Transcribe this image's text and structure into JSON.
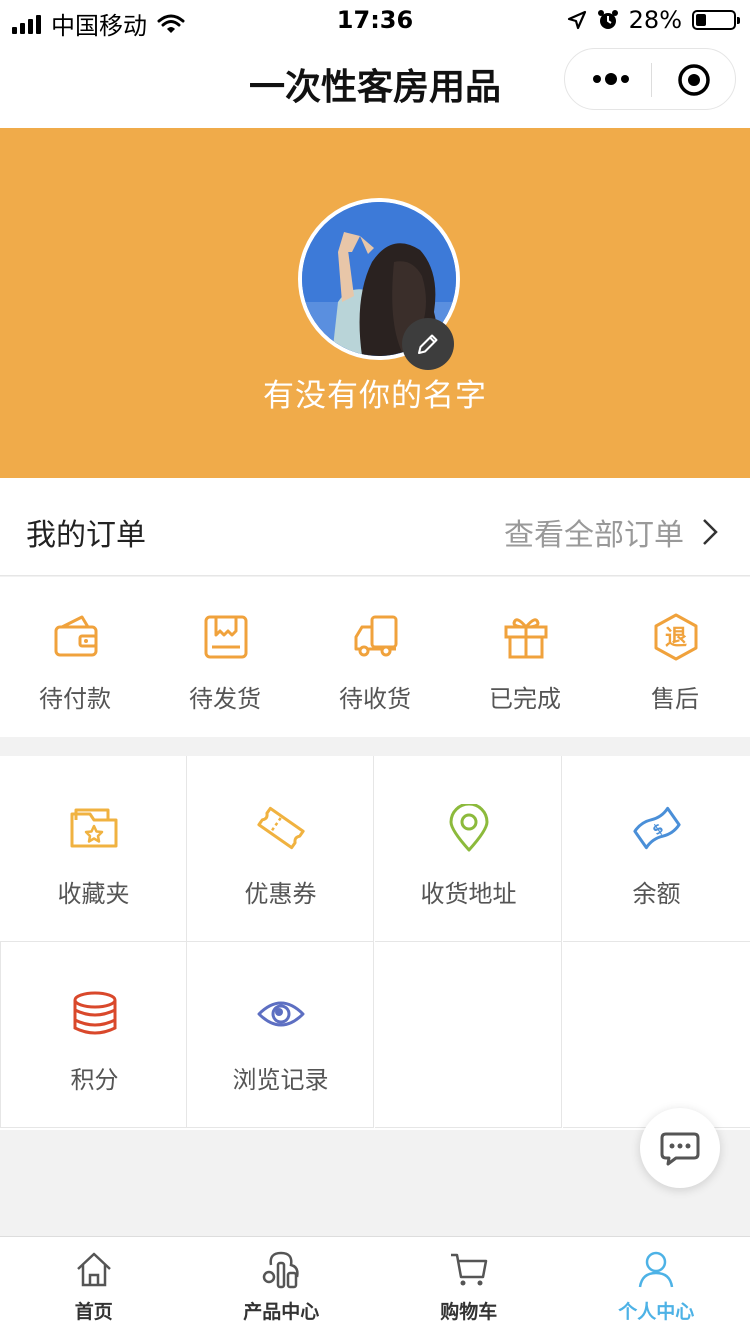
{
  "status_bar": {
    "carrier": "中国移动",
    "time": "17:36",
    "battery": "28%"
  },
  "nav": {
    "title": "一次性客房用品"
  },
  "profile": {
    "username": "有没有你的名字"
  },
  "orders": {
    "title": "我的订单",
    "view_all": "查看全部订单",
    "items": [
      {
        "label": "待付款",
        "icon": "wallet-icon"
      },
      {
        "label": "待发货",
        "icon": "package-icon"
      },
      {
        "label": "待收货",
        "icon": "truck-icon"
      },
      {
        "label": "已完成",
        "icon": "gift-icon"
      },
      {
        "label": "售后",
        "icon": "refund-icon",
        "badge": "退"
      }
    ]
  },
  "features": [
    {
      "label": "收藏夹",
      "icon": "favorites-folder-icon"
    },
    {
      "label": "优惠券",
      "icon": "coupon-icon"
    },
    {
      "label": "收货地址",
      "icon": "location-pin-icon"
    },
    {
      "label": "余额",
      "icon": "balance-icon"
    },
    {
      "label": "积分",
      "icon": "points-coins-icon"
    },
    {
      "label": "浏览记录",
      "icon": "eye-icon"
    }
  ],
  "tabbar": {
    "items": [
      {
        "label": "首页",
        "icon": "home-icon"
      },
      {
        "label": "产品中心",
        "icon": "product-center-icon"
      },
      {
        "label": "购物车",
        "icon": "cart-icon"
      },
      {
        "label": "个人中心",
        "icon": "user-icon",
        "active": true
      }
    ]
  },
  "colors": {
    "header": "#f0ab4a",
    "orange": "#f0a23c",
    "active_tab": "#4db2e6"
  }
}
